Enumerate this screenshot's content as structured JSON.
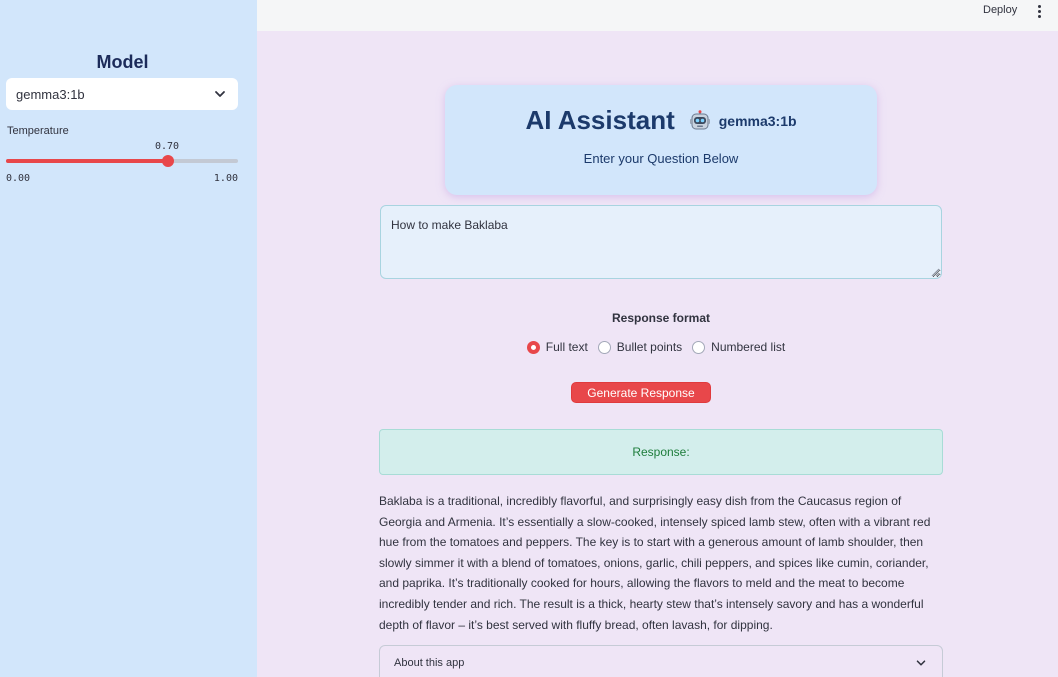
{
  "sidebar": {
    "title": "Model",
    "model_select": {
      "value": "gemma3:1b",
      "icon": "chevron-down-icon"
    },
    "temperature": {
      "label": "Temperature",
      "value": 0.7,
      "value_text": "0.70",
      "min_text": "0.00",
      "max_text": "1.00"
    }
  },
  "topbar": {
    "deploy_label": "Deploy",
    "menu_icon": "kebab-menu-icon"
  },
  "header_card": {
    "title": "AI Assistant",
    "icon": "robot-icon",
    "model_name": "gemma3:1b",
    "subtitle": "Enter your Question Below"
  },
  "question": {
    "value": "How to make Baklaba"
  },
  "response_format": {
    "label": "Response format",
    "options": [
      {
        "label": "Full text",
        "selected": true
      },
      {
        "label": "Bullet points",
        "selected": false
      },
      {
        "label": "Numbered list",
        "selected": false
      }
    ]
  },
  "generate_button": {
    "label": "Generate Response"
  },
  "response": {
    "heading": "Response:",
    "body": "Baklaba is a traditional, incredibly flavorful, and surprisingly easy dish from the Caucasus region of Georgia and Armenia. It’s essentially a slow-cooked, intensely spiced lamb stew, often with a vibrant red hue from the tomatoes and peppers. The key is to start with a generous amount of lamb shoulder, then slowly simmer it with a blend of tomatoes, onions, garlic, chili peppers, and spices like cumin, coriander, and paprika. It’s traditionally cooked for hours, allowing the flavors to meld and the meat to become incredibly tender and rich. The result is a thick, hearty stew that’s intensely savory and has a wonderful depth of flavor – it’s best served with fluffy bread, often lavash, for dipping."
  },
  "about": {
    "label": "About this app",
    "icon": "chevron-down-icon"
  },
  "colors": {
    "sidebar_bg": "#d2e6fb",
    "main_bg": "#efe5f6",
    "accent": "#e8474a",
    "success_bg": "#d3eeec",
    "success_text": "#1e7d3c",
    "heading": "#1c3a6b"
  }
}
